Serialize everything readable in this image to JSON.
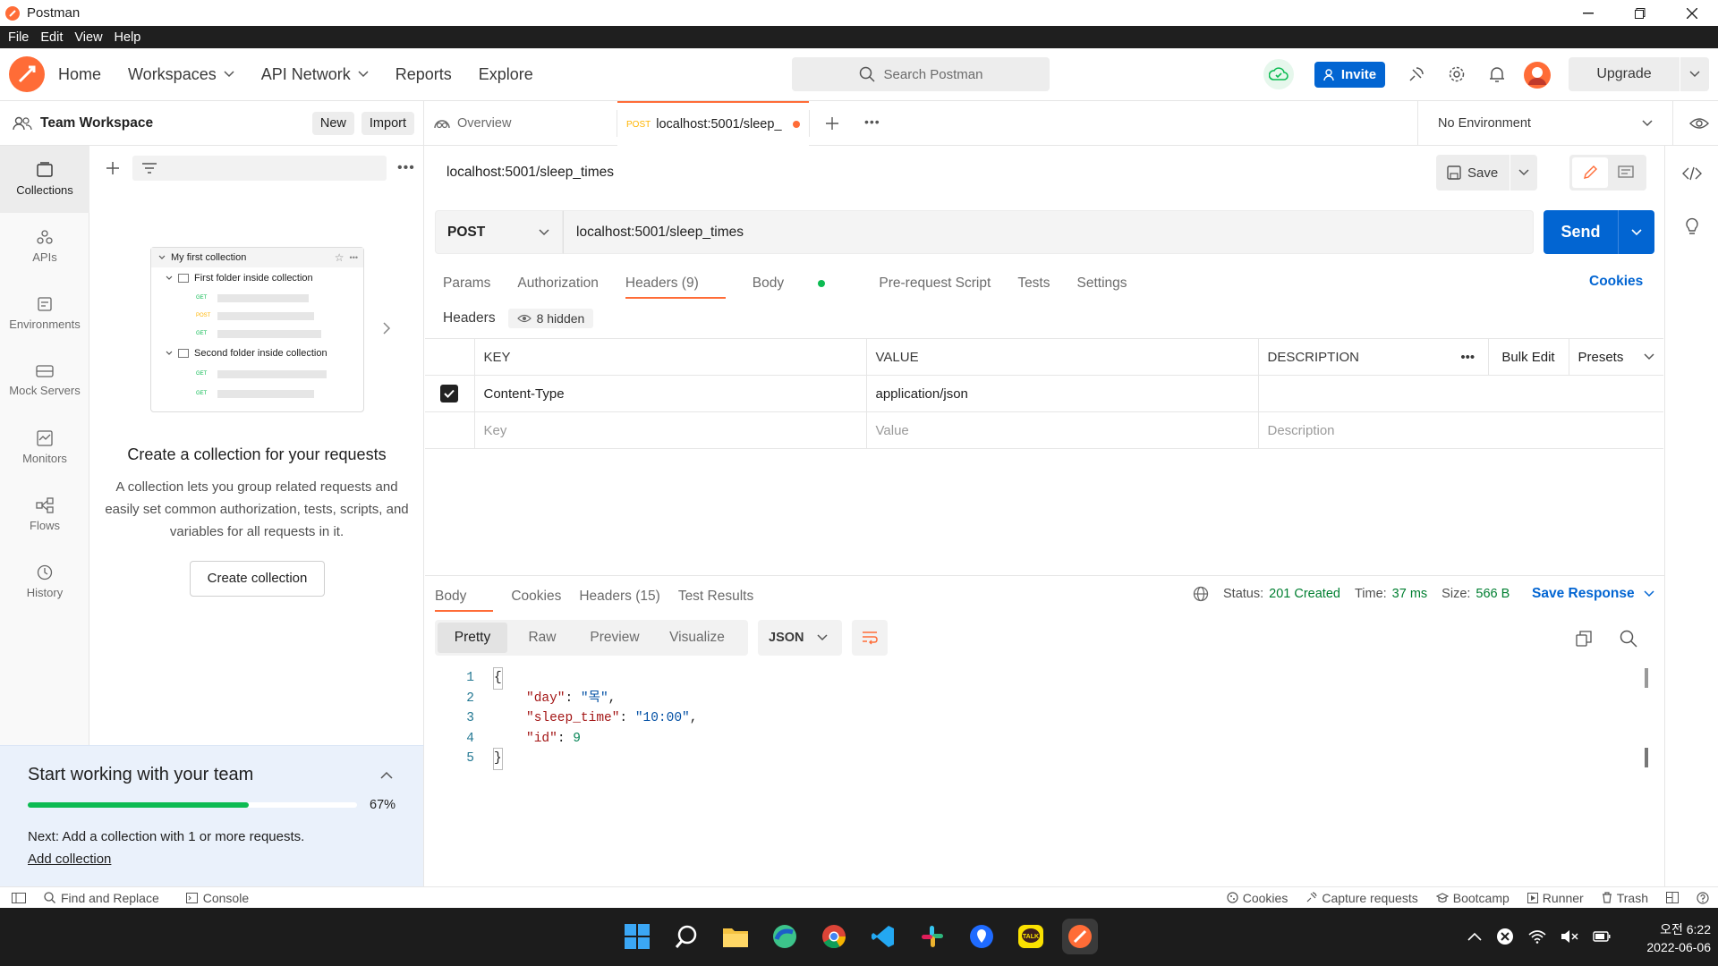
{
  "window": {
    "title": "Postman"
  },
  "menu": [
    "File",
    "Edit",
    "View",
    "Help"
  ],
  "header": {
    "nav": [
      "Home",
      "Workspaces",
      "API Network",
      "Reports",
      "Explore"
    ],
    "search_placeholder": "Search Postman",
    "invite": "Invite",
    "upgrade": "Upgrade"
  },
  "workspace": {
    "name": "Team Workspace",
    "new": "New",
    "import": "Import"
  },
  "rail": [
    {
      "label": "Collections",
      "icon": "collections-icon"
    },
    {
      "label": "APIs",
      "icon": "apis-icon"
    },
    {
      "label": "Environments",
      "icon": "environments-icon"
    },
    {
      "label": "Mock Servers",
      "icon": "mock-servers-icon"
    },
    {
      "label": "Monitors",
      "icon": "monitors-icon"
    },
    {
      "label": "Flows",
      "icon": "flows-icon"
    },
    {
      "label": "History",
      "icon": "history-icon"
    }
  ],
  "collection_preview": {
    "root": "My first collection",
    "folder1": "First folder inside collection",
    "folder2": "Second folder inside collection",
    "methods": [
      "GET",
      "POST",
      "GET",
      "GET",
      "GET"
    ]
  },
  "empty_state": {
    "title": "Create a collection for your requests",
    "body": "A collection lets you group related requests and easily set common authorization, tests, scripts, and variables for all requests in it.",
    "button": "Create collection"
  },
  "onboarding": {
    "title": "Start working with your team",
    "progress_label": "67%",
    "progress": 0.67,
    "next": "Next: Add a collection with 1 or more requests.",
    "link": "Add collection"
  },
  "tabs": {
    "overview": "Overview",
    "active_method": "POST",
    "active_label": "localhost:5001/sleep_"
  },
  "environment": "No Environment",
  "request": {
    "title": "localhost:5001/sleep_times",
    "save": "Save",
    "method": "POST",
    "url": "localhost:5001/sleep_times",
    "send": "Send",
    "subtabs": [
      "Params",
      "Authorization",
      "Headers (9)",
      "Body",
      "Pre-request Script",
      "Tests",
      "Settings"
    ],
    "cookies": "Cookies",
    "headers_label": "Headers",
    "hidden": "8 hidden",
    "columns": [
      "KEY",
      "VALUE",
      "DESCRIPTION"
    ],
    "bulk_edit": "Bulk Edit",
    "presets": "Presets",
    "rows": [
      {
        "key": "Content-Type",
        "value": "application/json"
      }
    ],
    "placeholders": {
      "key": "Key",
      "value": "Value",
      "description": "Description"
    }
  },
  "response": {
    "tabs": [
      "Body",
      "Cookies",
      "Headers (15)",
      "Test Results"
    ],
    "status_label": "Status:",
    "status": "201 Created",
    "time_label": "Time:",
    "time": "37 ms",
    "size_label": "Size:",
    "size": "566 B",
    "save_response": "Save Response",
    "views": [
      "Pretty",
      "Raw",
      "Preview",
      "Visualize"
    ],
    "format": "JSON",
    "lines": [
      "1",
      "2",
      "3",
      "4",
      "5"
    ],
    "json": {
      "open": "{",
      "k1": "\"day\"",
      "v1": "\"목\"",
      "k2": "\"sleep_time\"",
      "v2": "\"10:00\"",
      "k3": "\"id\"",
      "v3": "9",
      "close": "}"
    }
  },
  "footer": {
    "find": "Find and Replace",
    "console": "Console",
    "cookies": "Cookies",
    "capture": "Capture requests",
    "bootcamp": "Bootcamp",
    "runner": "Runner",
    "trash": "Trash"
  },
  "taskbar": {
    "time": "오전 6:22",
    "date": "2022-06-06"
  },
  "colors": {
    "brand": "#ff6c37",
    "accent": "#0265d2",
    "status_ok": "#007f31",
    "progress": "#0cbb52"
  }
}
